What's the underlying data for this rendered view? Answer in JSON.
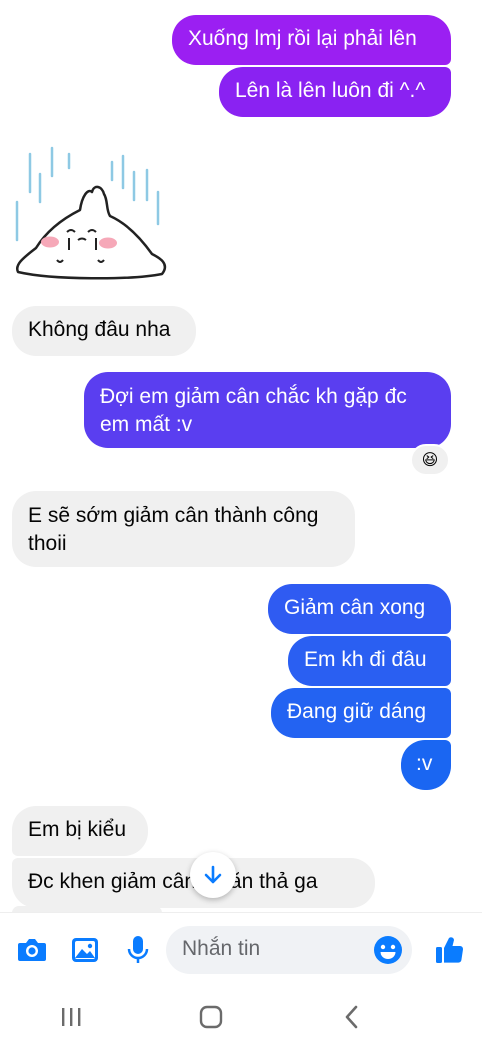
{
  "messages": [
    {
      "side": "out",
      "text": "Xuống lmj rồi lại phải lên"
    },
    {
      "side": "out",
      "text": "Lên là lên luôn đi ^.^"
    },
    {
      "side": "in",
      "type": "sticker",
      "sticker": "crying-bunny-sticker"
    },
    {
      "side": "in",
      "text": "Không đâu nha"
    },
    {
      "side": "out",
      "lines": [
        "Đợi em giảm cân chắc kh gặp đc",
        "em mất :v"
      ]
    },
    {
      "reaction": "😆"
    },
    {
      "side": "in",
      "lines": [
        "E sẽ sớm giảm cân thành công",
        "thoii"
      ]
    },
    {
      "side": "out",
      "text": "Giảm cân xong"
    },
    {
      "side": "out",
      "text": "Em kh đi đâu"
    },
    {
      "side": "out",
      "text": "Đang giữ dáng"
    },
    {
      "side": "out",
      "text": ":v"
    },
    {
      "side": "in",
      "text": "Em bị kiểu"
    },
    {
      "side": "in",
      "text": "Đc khen giảm cân về ăn thả ga"
    }
  ],
  "composer": {
    "placeholder": "Nhắn tin",
    "icons": [
      "camera-icon",
      "image-icon",
      "microphone-icon",
      "emoji-icon",
      "like-icon"
    ]
  },
  "nav_icons": [
    "recent-apps-icon",
    "home-icon",
    "back-icon"
  ],
  "colors": {
    "gradient_top": "#9b1ff2",
    "gradient_mid": "#5a3ef0",
    "gradient_bottom": "#1a66f2",
    "incoming": "#f0f0f0",
    "accent": "#0a7cff"
  }
}
